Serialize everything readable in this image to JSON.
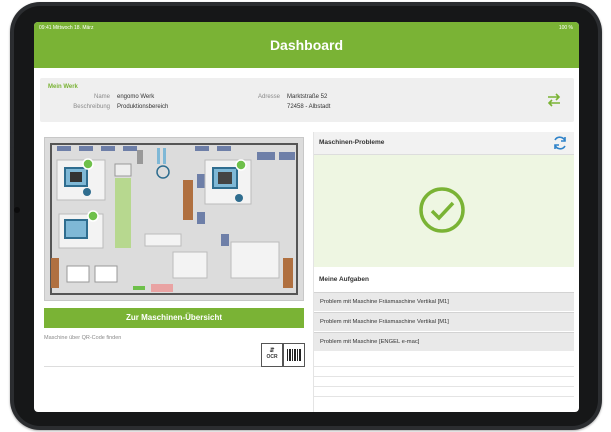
{
  "status_bar": {
    "time": "09:41  Mittwoch 18. März",
    "battery": "100 %"
  },
  "header": {
    "title": "Dashboard"
  },
  "werk": {
    "section_title": "Mein Werk",
    "name_label": "Name",
    "name_value": "engomo Werk",
    "beschreibung_label": "Beschreibung",
    "beschreibung_value": "Produktionsbereich",
    "adresse_label": "Adresse",
    "adresse_line1": "Marktstraße 52",
    "adresse_line2": "72458 - Albstadt"
  },
  "icons": {
    "swap": "swap-arrows-icon",
    "refresh": "refresh-icon",
    "success": "check-circle-icon",
    "ocr": "ocr-scan-icon",
    "barcode": "barcode-scan-icon"
  },
  "actions": {
    "overview_button": "Zur Maschinen-Übersicht"
  },
  "qr": {
    "label": "Maschine über QR-Code finden",
    "ocr_text": "OCR"
  },
  "problems": {
    "title": "Maschinen-Probleme"
  },
  "tasks": {
    "title": "Meine Aufgaben",
    "items": [
      "Problem mit Maschine Fräsmaschine Vertikal [M1]",
      "Problem mit Maschine Fräsmaschine Vertikal [M1]",
      "Problem mit Maschine  [ENGEL e-mac]"
    ]
  },
  "colors": {
    "brand": "#7ab335",
    "problem_bg": "#eef6e2",
    "alert": "#6ec04a"
  }
}
